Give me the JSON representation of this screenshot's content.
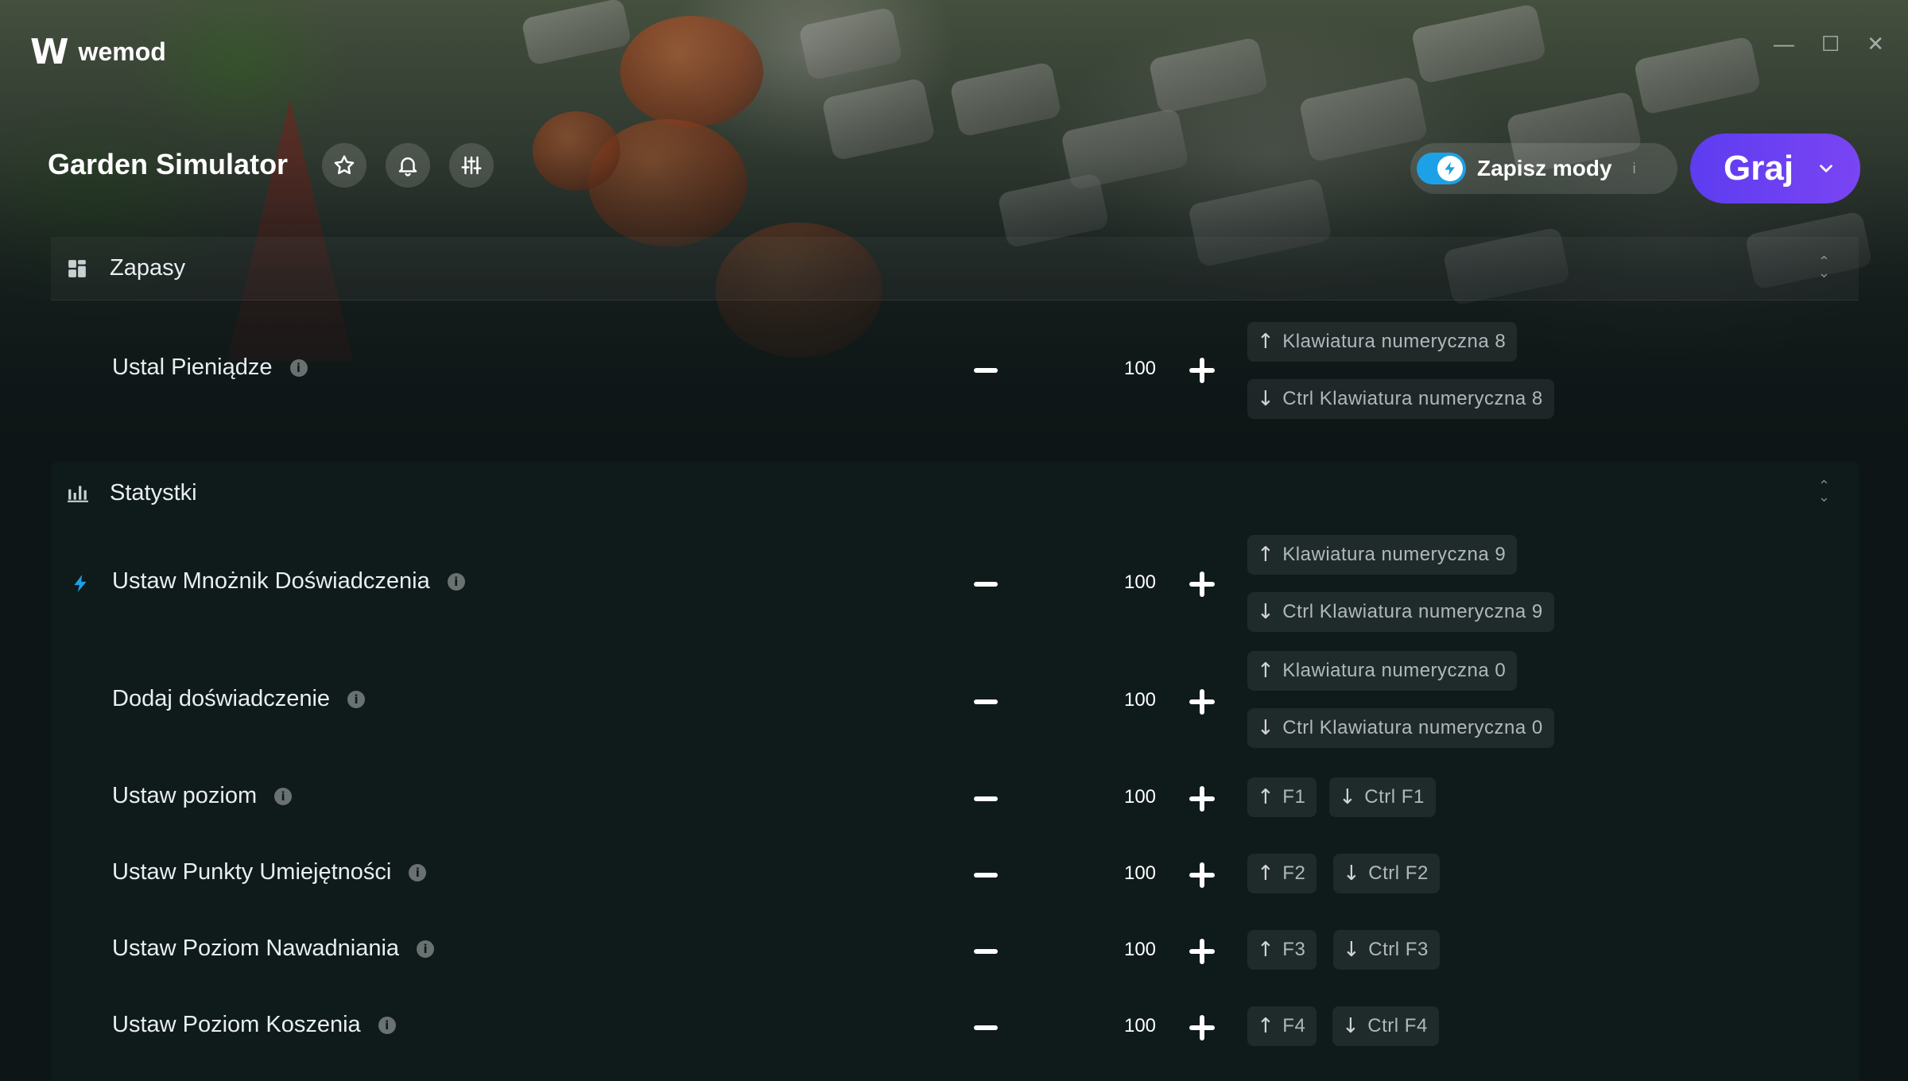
{
  "app": {
    "name": "wemod",
    "window_controls": [
      "—",
      "☐",
      "✕"
    ]
  },
  "header": {
    "game_title": "Garden Simulator",
    "save_mods_label": "Zapisz mody",
    "save_mods_enabled": true,
    "play_label": "Graj",
    "info_glyph": "i"
  },
  "sections": [
    {
      "title": "Zapasy",
      "icon": "grid-icon",
      "rows": [
        {
          "label": "Ustal Pieniądze",
          "value": "100",
          "keys": [
            [
              "↑",
              "Klawiatura numeryczna 8"
            ],
            [
              "↓",
              "Ctrl Klawiatura numeryczna 8"
            ]
          ]
        }
      ]
    },
    {
      "title": "Statystki",
      "icon": "bar-chart-icon",
      "rows": [
        {
          "label": "Ustaw Mnożnik Doświadczenia",
          "value": "100",
          "icon": "lightning-icon",
          "keys": [
            [
              "↑",
              "Klawiatura numeryczna 9"
            ],
            [
              "↓",
              "Ctrl Klawiatura numeryczna 9"
            ]
          ]
        },
        {
          "label": "Dodaj doświadczenie",
          "value": "100",
          "keys": [
            [
              "↑",
              "Klawiatura numeryczna 0"
            ],
            [
              "↓",
              "Ctrl Klawiatura numeryczna 0"
            ]
          ]
        },
        {
          "label": "Ustaw poziom",
          "value": "100",
          "keys": [
            [
              "↑",
              "F1"
            ],
            [
              "↓",
              "Ctrl F1"
            ]
          ]
        },
        {
          "label": "Ustaw Punkty Umiejętności",
          "value": "100",
          "keys": [
            [
              "↑",
              "F2"
            ],
            [
              "↓",
              "Ctrl F2"
            ]
          ]
        },
        {
          "label": "Ustaw Poziom Nawadniania",
          "value": "100",
          "keys": [
            [
              "↑",
              "F3"
            ],
            [
              "↓",
              "Ctrl F3"
            ]
          ]
        },
        {
          "label": "Ustaw Poziom Koszenia",
          "value": "100",
          "keys": [
            [
              "↑",
              "F4"
            ],
            [
              "↓",
              "Ctrl F4"
            ]
          ]
        }
      ]
    }
  ]
}
